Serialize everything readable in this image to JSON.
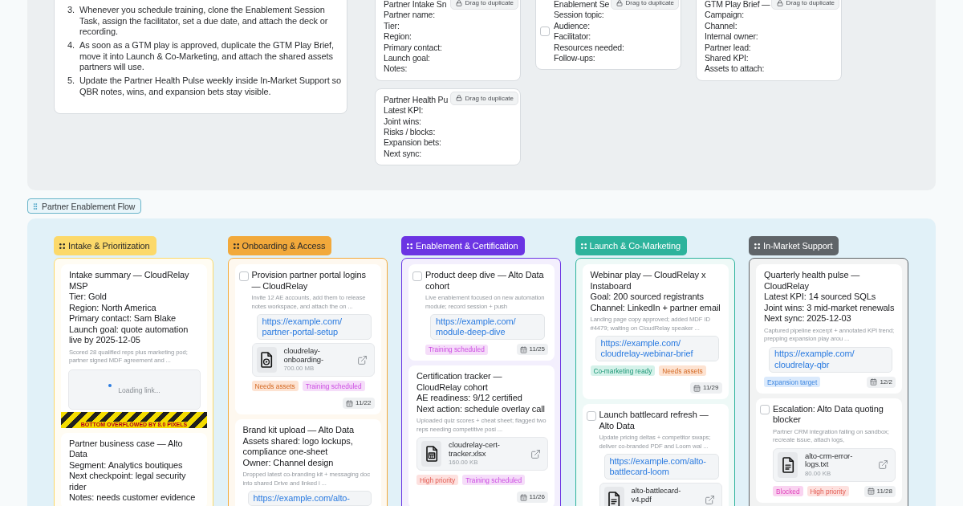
{
  "instructions": {
    "steps": [
      {
        "number": "3.",
        "text": "Whenever you schedule training, clone the Enablement Session Task, assign the facilitator, set a due date, and attach the deck or recording."
      },
      {
        "number": "4.",
        "text": "As soon as a GTM play is approved, duplicate the GTM Play Brief, move it into Launch & Co-Marketing, and attach the shared assets partners will use."
      },
      {
        "number": "5.",
        "text": "Update the Partner Health Pulse weekly inside In-Market Support so QBR notes, wins, and expansion bets stay visible."
      }
    ]
  },
  "templates": [
    {
      "kind": "note",
      "title": "Partner Intake Sn",
      "handle": "Drag to duplicate",
      "fields": [
        "Partner name:",
        "Tier:",
        "Region:",
        "Primary contact:",
        "Launch goal:",
        "Notes:"
      ]
    },
    {
      "kind": "task",
      "checked": false,
      "title": "Enablement Se",
      "handle": "Drag to duplicate",
      "fields": [
        "Session topic:",
        "Audience:",
        "Facilitator:",
        "Resources needed:",
        "Follow-ups:"
      ]
    },
    {
      "kind": "note",
      "title": "GTM Play Brief —",
      "handle": "Drag to duplicate",
      "fields": [
        "Campaign:",
        "Channel:",
        "Internal owner:",
        "Partner lead:",
        "Shared KPI:",
        "Assets to attach:"
      ]
    },
    {
      "kind": "note",
      "title": "Partner Health Pu",
      "handle": "Drag to duplicate",
      "fields": [
        "Latest KPI:",
        "Joint wins:",
        "Risks / blocks:",
        "Expansion bets:",
        "Next sync:"
      ]
    }
  ],
  "board": {
    "title": "Partner Enablement Flow",
    "columns": [
      {
        "title": "Intake & Prioritization",
        "color": "#fcd96a",
        "cards": [
          {
            "kind": "note",
            "lines": [
              "Intake summary — CloudRelay MSP",
              "Tier: Gold",
              "Region: North America",
              "Primary contact: Sam Blake",
              "Launch goal: quote automation live by 2025-12-05"
            ],
            "note": "Scored 28 qualified reps plus marketing pod; partner signed MDF agreement and ...",
            "link": {
              "kind": "loading",
              "text": "Loading link..."
            },
            "overflow_warning": "BOTTOM OVERFLOWED BY 8.0 PIXELS"
          },
          {
            "kind": "note",
            "lines": [
              "Partner business case — Alto Data",
              "Segment: Analytics boutiques",
              "Next checkpoint: legal security rider",
              "Notes: needs customer evidence"
            ]
          }
        ]
      },
      {
        "title": "Onboarding & Access",
        "color": "#f2a93b",
        "cards": [
          {
            "kind": "task",
            "checked": false,
            "lines": [
              "Provision partner portal logins — CloudRelay"
            ],
            "note": "Invite 12 AE accounts, add them to release notes workspace, and attach the on ...",
            "link": {
              "kind": "url",
              "text": "https://example.com/partner-portal-setup"
            },
            "attachment": {
              "kind": "video",
              "name": "cloudrelay-onboarding-",
              "size": "700.00 MB"
            },
            "tags": [
              {
                "label": "Needs assets",
                "color": "#fde3d2"
              },
              {
                "label": "Training scheduled",
                "color": "#f5ddf9"
              }
            ],
            "due": "11/22"
          },
          {
            "kind": "note",
            "lines": [
              "Brand kit upload — Alto Data",
              "Assets shared: logo lockups, compliance one-sheet",
              "Owner: Channel design"
            ],
            "note": "Dropped latest co-branding kit + messaging doc into shared Drive and linked i ...",
            "link": {
              "kind": "url",
              "text": "https://example.com/alto-"
            }
          }
        ]
      },
      {
        "title": "Enablement & Certification",
        "color": "#6b34e3",
        "cards": [
          {
            "kind": "task",
            "checked": false,
            "lines": [
              "Product deep dive — Alto Data cohort"
            ],
            "note": "Live enablement focused on new automation module; record session + push",
            "link": {
              "kind": "url",
              "text": "https://example.com/module-deep-dive"
            },
            "tags": [
              {
                "label": "Training scheduled",
                "color": "#f5ddf9"
              }
            ],
            "due": "11/25"
          },
          {
            "kind": "note",
            "lines": [
              "Certification tracker — CloudRelay cohort",
              "AE readiness: 9/12 certified",
              "Next action: schedule overlay call"
            ],
            "note": "Uploaded quiz scores + cheat sheet; flagged two reps needing competitive posi ...",
            "attachment": {
              "kind": "spreadsheet",
              "name": "cloudrelay-cert-tracker.xlsx",
              "size": "160.00 KB"
            },
            "tags": [
              {
                "label": "High priority",
                "color": "#fde1df"
              },
              {
                "label": "Training scheduled",
                "color": "#f5ddf9"
              }
            ],
            "due": "11/26"
          }
        ]
      },
      {
        "title": "Launch & Co-Marketing",
        "color": "#2db39c",
        "cards": [
          {
            "kind": "note",
            "lines": [
              "Webinar play — CloudRelay x Instaboard",
              "Goal: 200 sourced registrants",
              "Channel: LinkedIn + partner email"
            ],
            "note": "Landing page copy approved; added MDF ID #4479; waiting on CloudRelay speaker ...",
            "link": {
              "kind": "url",
              "text": "https://example.com/cloudrelay-webinar-brief"
            },
            "tags": [
              {
                "label": "Co-marketing ready",
                "color": "#d5f2ea"
              },
              {
                "label": "Needs assets",
                "color": "#fde3d2"
              }
            ],
            "due": "11/29"
          },
          {
            "kind": "task",
            "checked": false,
            "lines": [
              "Launch battlecard refresh — Alto Data"
            ],
            "note": "Update pricing deltas + competitor swaps; deliver co-branded PDF and Loom wal ...",
            "link": {
              "kind": "url",
              "text": "https://example.com/alto-battlecard-loom"
            },
            "attachment": {
              "kind": "document",
              "name": "alto-battlecard-v4.pdf"
            }
          }
        ]
      },
      {
        "title": "In-Market Support",
        "color": "#5f6468",
        "cards": [
          {
            "kind": "note",
            "lines": [
              "Quarterly health pulse — CloudRelay",
              "Latest KPI: 14 sourced SQLs",
              "Joint wins: 3 mid-market renewals",
              "Next sync: 2025-12-03"
            ],
            "note": "Captured pipeline excerpt + annotated KPI trend; prepping expansion play arou ...",
            "link": {
              "kind": "url",
              "text": "https://example.com/cloudrelay-qbr"
            },
            "tags": [
              {
                "label": "Expansion target",
                "color": "#dbeafc"
              }
            ],
            "due": "12/2"
          },
          {
            "kind": "task",
            "checked": false,
            "lines": [
              "Escalation: Alto Data quoting blocker"
            ],
            "note": "Partner CRM integration failing on sandbox; recreate issue, attach logs,",
            "attachment": {
              "kind": "document",
              "name": "alto-crm-error-logs.txt",
              "size": "80.00 KB"
            },
            "tags": [
              {
                "label": "Blocked",
                "color": "#f9d3f0"
              },
              {
                "label": "High priority",
                "color": "#fde1df"
              }
            ],
            "due": "11/28"
          }
        ]
      }
    ]
  }
}
